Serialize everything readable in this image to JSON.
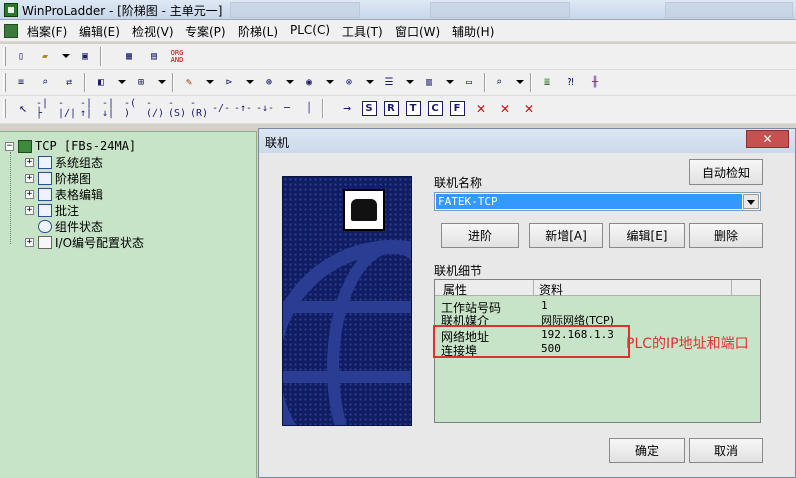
{
  "window": {
    "title": "WinProLadder - [阶梯图 - 主单元一]"
  },
  "menu": [
    "档案(F)",
    "编辑(E)",
    "检视(V)",
    "专案(P)",
    "阶梯(L)",
    "PLC(C)",
    "工具(T)",
    "窗口(W)",
    "辅助(H)"
  ],
  "toolbar1": {
    "icons": [
      "new-icon",
      "open-icon",
      "save-icon",
      "ladder-view-icon",
      "table-view-icon",
      "org-and-icon"
    ],
    "org_label_top": "ORG",
    "org_label_bottom": "AND"
  },
  "toolbar3": {
    "letters": [
      "S",
      "R",
      "T",
      "C",
      "F"
    ]
  },
  "tree": {
    "root": "TCP [FBs-24MA]",
    "items": [
      {
        "label": "系统组态",
        "expanded": false
      },
      {
        "label": "阶梯图",
        "expanded": false
      },
      {
        "label": "表格编辑",
        "expanded": false
      },
      {
        "label": "批注",
        "expanded": false
      },
      {
        "label": "组件状态",
        "expanded": null
      },
      {
        "label": "I/O编号配置状态",
        "expanded": false
      }
    ]
  },
  "dialog": {
    "title": "联机",
    "close_label": "✕",
    "auto_detect": "自动检知",
    "connection_name_label": "联机名称",
    "connection_name_value": "FATEK-TCP",
    "buttons": {
      "advanced": "进阶",
      "add": "新增[A]",
      "edit": "编辑[E]",
      "delete": "删除"
    },
    "details_label": "联机细节",
    "details_headers": [
      "属性",
      "资料"
    ],
    "details_rows": [
      {
        "key": "工作站号码",
        "value": "1"
      },
      {
        "key": "联机媒介",
        "value": "网际网络(TCP)"
      },
      {
        "key": "网络地址",
        "value": "192.168.1.3"
      },
      {
        "key": "连接埠",
        "value": "500"
      }
    ],
    "ok": "确定",
    "cancel": "取消",
    "annotation": "PLC的IP地址和端口"
  },
  "colors": {
    "tree_bg": "#c8e4c8",
    "highlight": "#e03030",
    "selected": "#3399ff",
    "art_bg": "#101d63"
  }
}
